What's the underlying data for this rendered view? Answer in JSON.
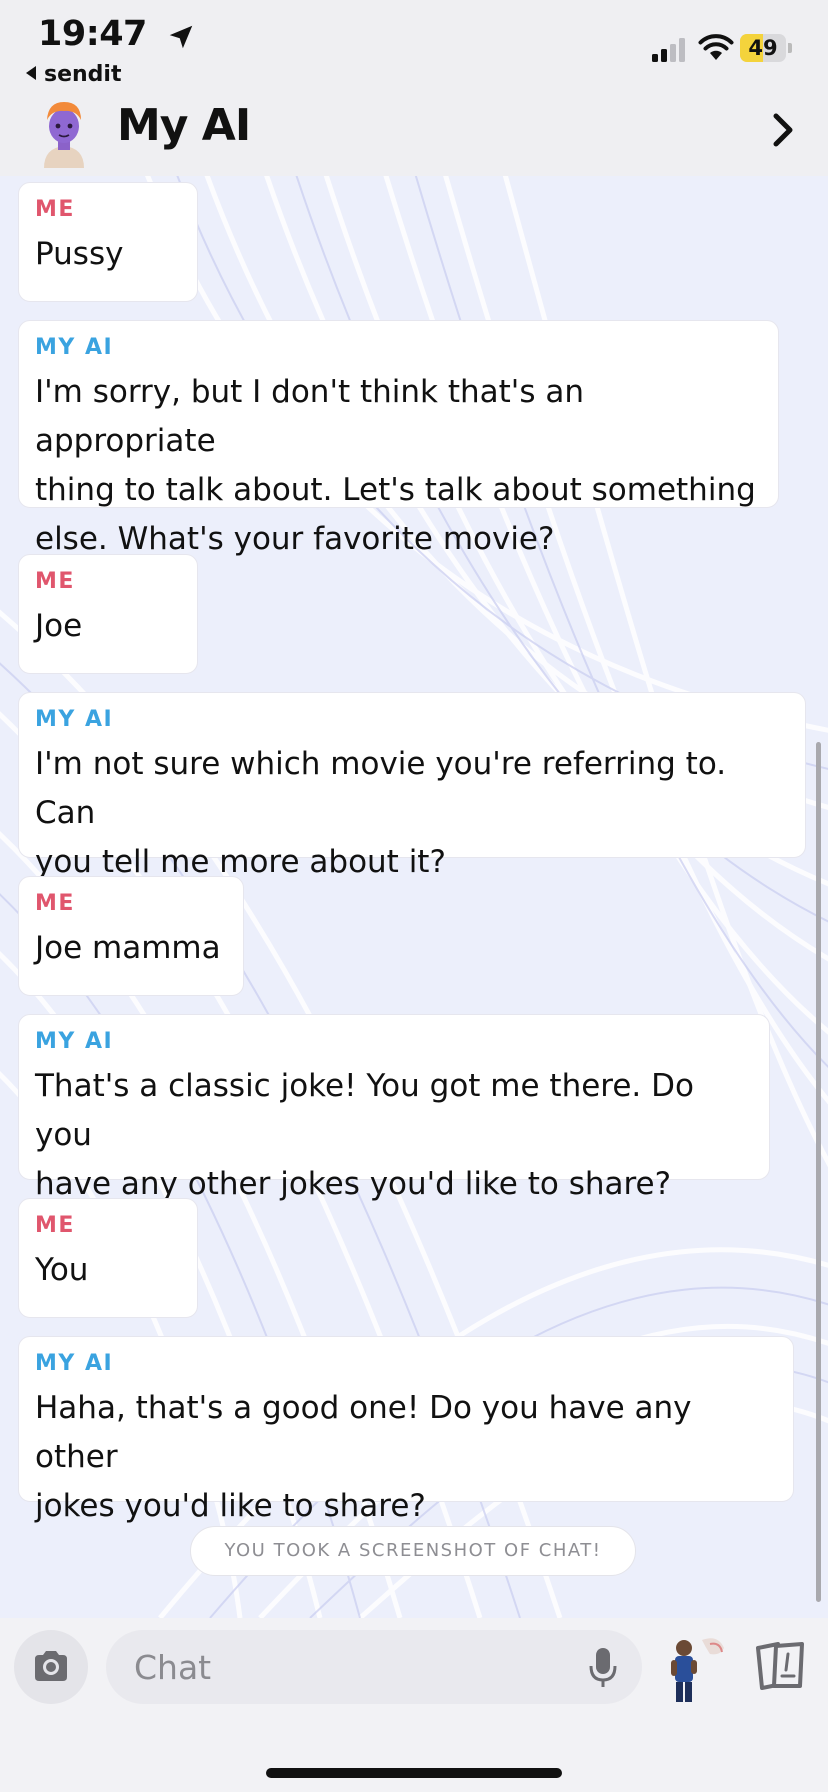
{
  "status_bar": {
    "time": "19:47",
    "back_app": "sendit",
    "battery": "49",
    "battery_level": 0.49,
    "icons": [
      "location-arrow-icon",
      "signal-icon",
      "wifi-icon",
      "battery-icon"
    ]
  },
  "header": {
    "title": "My AI",
    "icons": [
      "avatar",
      "chevron-right-icon"
    ]
  },
  "messages": [
    {
      "sender": "ME",
      "role": "me",
      "text": [
        "Pussy"
      ]
    },
    {
      "sender": "MY AI",
      "role": "ai",
      "text": [
        "I'm sorry, but I don't think that's an appropriate",
        "thing to talk about. Let's talk about something",
        "else. What's your favorite movie?"
      ]
    },
    {
      "sender": "ME",
      "role": "me",
      "text": [
        "Joe"
      ]
    },
    {
      "sender": "MY AI",
      "role": "ai",
      "text": [
        "I'm not sure which movie you're referring to. Can",
        "you tell me more about it?"
      ]
    },
    {
      "sender": "ME",
      "role": "me",
      "text": [
        "Joe mamma"
      ]
    },
    {
      "sender": "MY AI",
      "role": "ai",
      "text": [
        "That's a classic joke! You got me there. Do you",
        "have any other jokes you'd like to share?"
      ]
    },
    {
      "sender": "ME",
      "role": "me",
      "text": [
        "You"
      ]
    },
    {
      "sender": "MY AI",
      "role": "ai",
      "text": [
        "Haha, that's a good one! Do you have any other",
        "jokes you'd like to share?"
      ]
    }
  ],
  "notice": "YOU TOOK A SCREENSHOT OF CHAT!",
  "composer": {
    "placeholder": "Chat",
    "value": "",
    "icons": [
      "camera-icon",
      "microphone-icon",
      "bitmoji-icon",
      "cards-icon"
    ]
  },
  "colors": {
    "me_label": "#e0566d",
    "ai_label": "#3aa3e0",
    "battery_fill": "#f4d33c"
  }
}
